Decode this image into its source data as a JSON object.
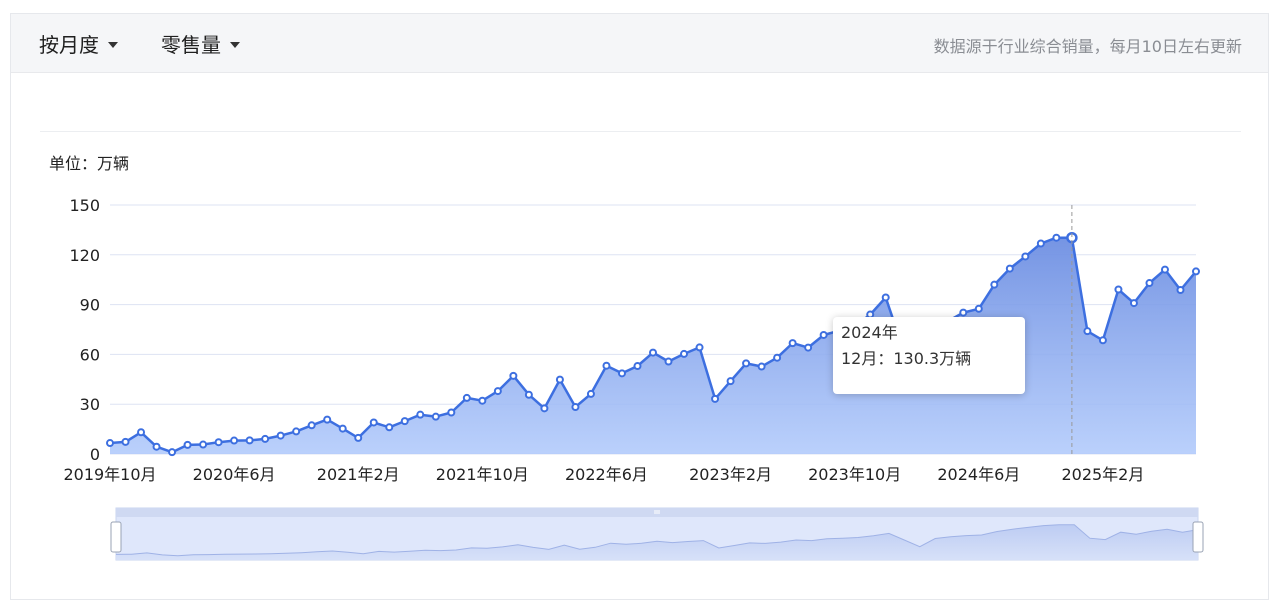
{
  "toolbar": {
    "period_label": "按月度",
    "metric_label": "零售量",
    "source_note": "数据源于行业综合销量，每月10日左右更新"
  },
  "colors": {
    "line": "#3d6fe0",
    "area_top": "#6e8fe2",
    "area_bottom": "#aec8fb",
    "grid": "#dde3f3",
    "slider_bg": "#dfe7fb"
  },
  "chart_data": {
    "type": "area",
    "unit_label": "单位：万辆",
    "ylim": [
      0,
      150
    ],
    "yticks": [
      "0",
      "30",
      "60",
      "90",
      "120",
      "150"
    ],
    "xtick_labels": [
      "2019年10月",
      "2020年6月",
      "2021年2月",
      "2021年10月",
      "2022年6月",
      "2023年2月",
      "2023年10月",
      "2024年6月",
      "2025年2月"
    ],
    "series": [
      {
        "x": [
          "2019-10",
          "2019-11",
          "2019-12",
          "2020-01",
          "2020-02",
          "2020-03",
          "2020-04",
          "2020-05",
          "2020-06",
          "2020-07",
          "2020-08",
          "2020-09",
          "2020-10",
          "2020-11",
          "2020-12",
          "2021-01",
          "2021-02",
          "2021-03",
          "2021-04",
          "2021-05",
          "2021-06",
          "2021-07",
          "2021-08",
          "2021-09",
          "2021-10",
          "2021-11",
          "2021-12",
          "2022-01",
          "2022-02",
          "2022-03",
          "2022-04",
          "2022-05",
          "2022-06",
          "2022-07",
          "2022-08",
          "2022-09",
          "2022-10",
          "2022-11",
          "2022-12",
          "2023-01",
          "2023-02",
          "2023-03",
          "2023-04",
          "2023-05",
          "2023-06",
          "2023-07",
          "2023-08",
          "2023-09",
          "2023-10",
          "2023-11",
          "2023-12",
          "2024-01",
          "2024-02",
          "2024-03",
          "2024-04",
          "2024-05",
          "2024-06",
          "2024-07",
          "2024-08",
          "2024-09",
          "2024-10",
          "2024-11",
          "2024-12",
          "2025-01",
          "2025-02",
          "2025-03",
          "2025-04",
          "2025-05",
          "2025-06",
          "2025-07",
          "2025-08"
        ],
        "values": [
          6.6,
          7.3,
          13.1,
          4.4,
          1.1,
          5.5,
          5.7,
          7.1,
          8.1,
          8.2,
          9.1,
          11.1,
          13.6,
          17.3,
          20.7,
          15.3,
          9.7,
          19.0,
          16.1,
          19.8,
          23.7,
          22.5,
          25.0,
          33.8,
          32.1,
          37.9,
          47.1,
          35.7,
          27.5,
          44.8,
          28.3,
          36.2,
          53.2,
          48.6,
          53.0,
          61.1,
          55.7,
          60.3,
          64.2,
          33.2,
          43.9,
          54.6,
          52.7,
          58.0,
          66.8,
          64.1,
          71.7,
          74.3,
          77.1,
          84.0,
          94.3,
          66.8,
          38.8,
          72.9,
          80.0,
          85.2,
          87.5,
          102.0,
          111.7,
          119.0,
          126.8,
          130.3,
          130.3,
          74.0,
          68.5,
          99.1,
          90.9,
          103.0,
          111.1,
          98.8,
          110.0
        ]
      }
    ],
    "tooltip": {
      "title": "2024年",
      "line": "12月：130.3万辆",
      "index": 62
    },
    "zoom_range": [
      0,
      100
    ]
  }
}
